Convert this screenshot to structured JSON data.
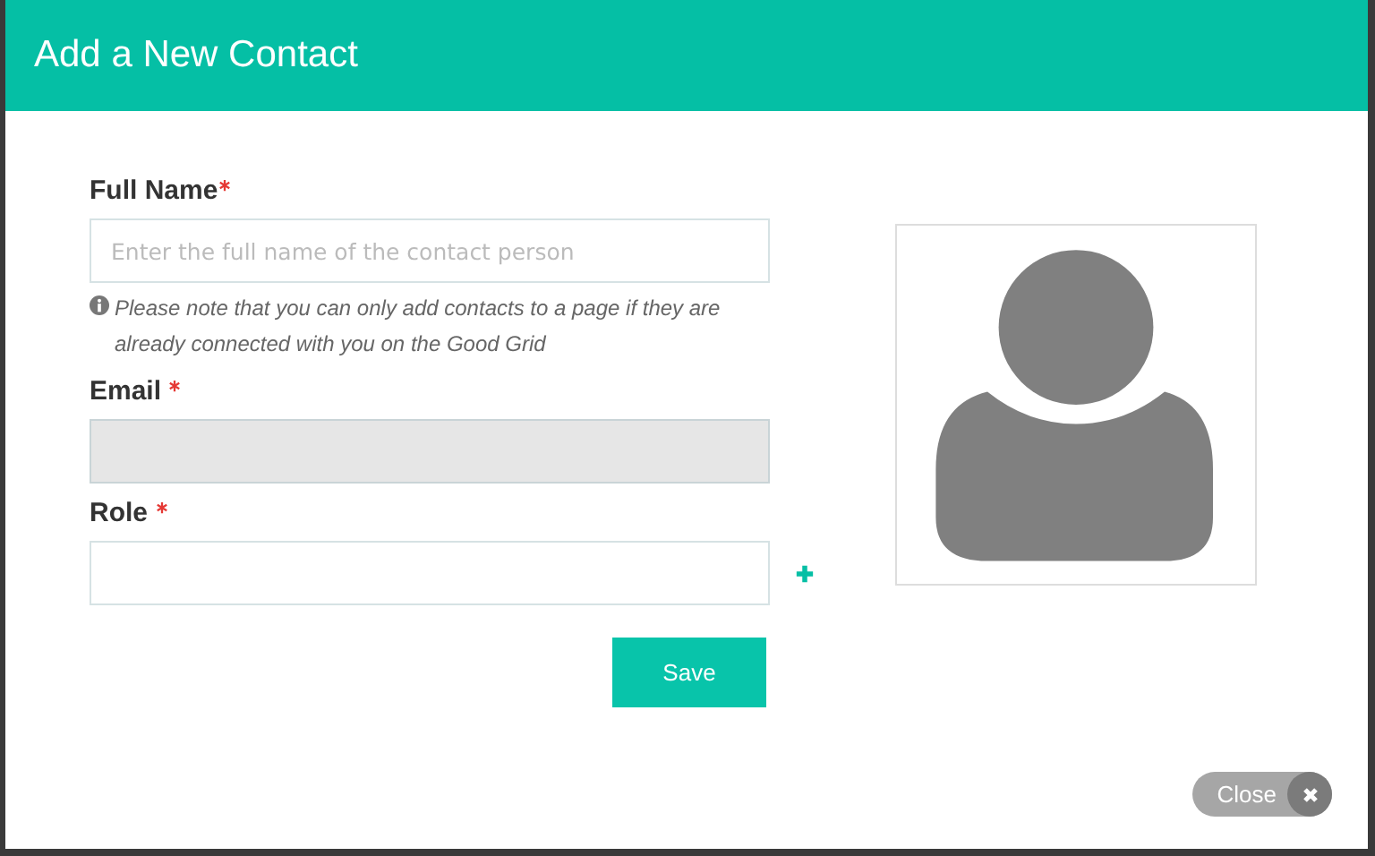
{
  "dialog": {
    "title": "Add a New Contact"
  },
  "fields": [
    {
      "label": "Full Name",
      "required": true,
      "placeholder": "Enter the full name of the contact person",
      "disabled": false,
      "note": "Please note that you can only add contacts to a page if they are already connected with you on the Good Grid",
      "add_button": false
    },
    {
      "label": "Email",
      "required": true,
      "disabled": true,
      "add_button": false
    },
    {
      "label": "Role",
      "required": true,
      "disabled": false,
      "add_button": true
    }
  ],
  "save_button": "Save",
  "close_button": "Close"
}
